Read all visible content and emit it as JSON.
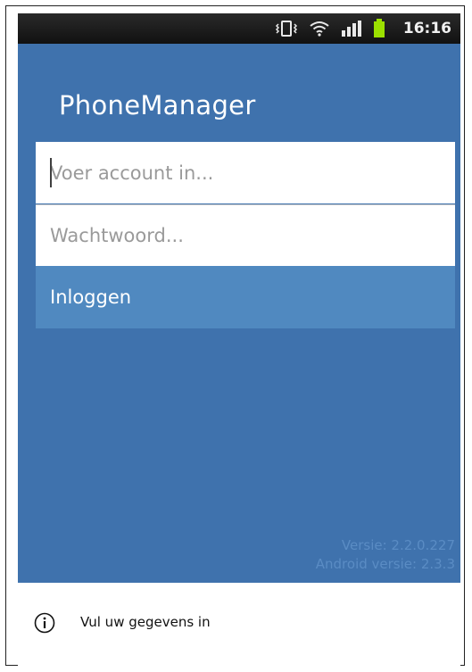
{
  "status_bar": {
    "time": "16:16",
    "icons": [
      "vibrate-icon",
      "wifi-icon",
      "signal-icon",
      "battery-icon"
    ]
  },
  "app": {
    "title": "PhoneManager"
  },
  "login": {
    "account_placeholder": "Voer account in...",
    "password_placeholder": "Wachtwoord...",
    "login_label": "Inloggen"
  },
  "version": {
    "app_version": "Versie: 2.2.0.227",
    "android_version": "Android versie: 2.3.3"
  },
  "info": {
    "message": "Vul uw gegevens in"
  },
  "colors": {
    "background_blue": "#3f72ad",
    "button_blue": "#5089c0",
    "version_text": "#5a8cc4",
    "battery_green": "#9be000"
  }
}
